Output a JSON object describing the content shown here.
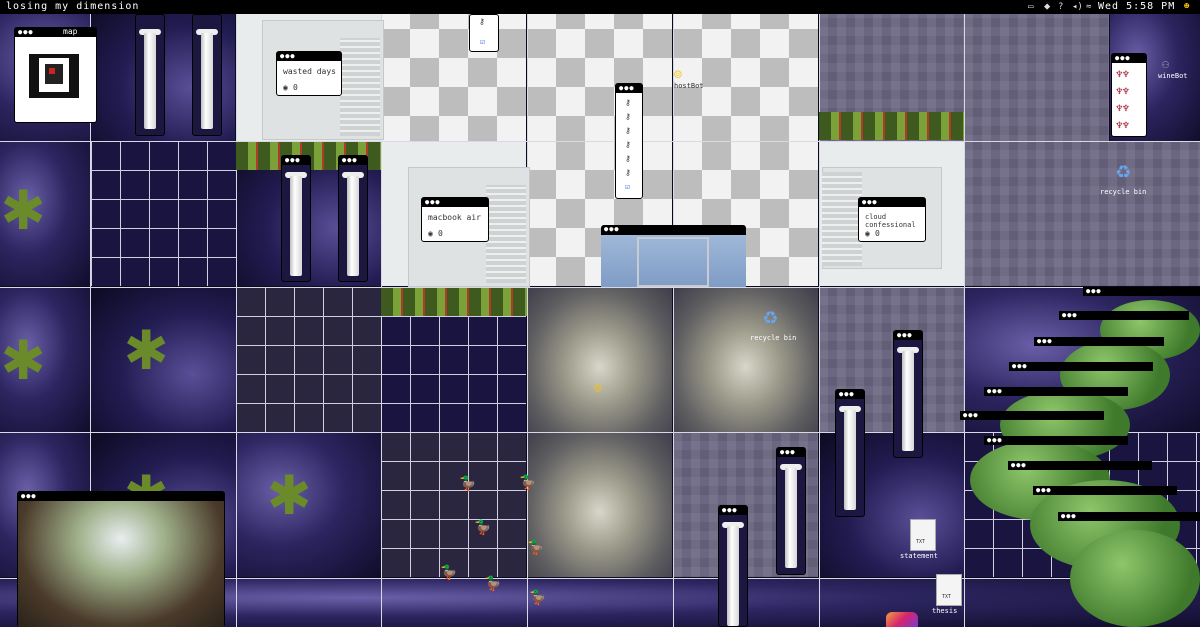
{
  "menubar": {
    "app_title": "losing my dimension",
    "clock": "Wed 5:58 PM",
    "status_icons": [
      "chat-icon",
      "location-icon",
      "help-icon",
      "volume-icon",
      "wifi-icon"
    ]
  },
  "desktop": {
    "windows": {
      "map_title": "map",
      "wasted_days": "wasted days",
      "wasted_days_views": "0",
      "macbook_air": "macbook air",
      "macbook_air_views": "0",
      "cloud_confessional": "cloud confessional",
      "cloud_confessional_views": "0",
      "window_dots": "●●●"
    },
    "icons": {
      "hostbot": "hostBot",
      "winebot": "wineBot",
      "recycle_bin_1": "recycle bin",
      "recycle_bin_2": "recycle bin",
      "statement": "statement",
      "thesis": "thesis",
      "txt_badge": "TXT"
    }
  },
  "colors": {
    "menubar_bg": "#000000",
    "space": "#2c2560",
    "marble": "#e9ecec",
    "window_bar": "#000000"
  }
}
